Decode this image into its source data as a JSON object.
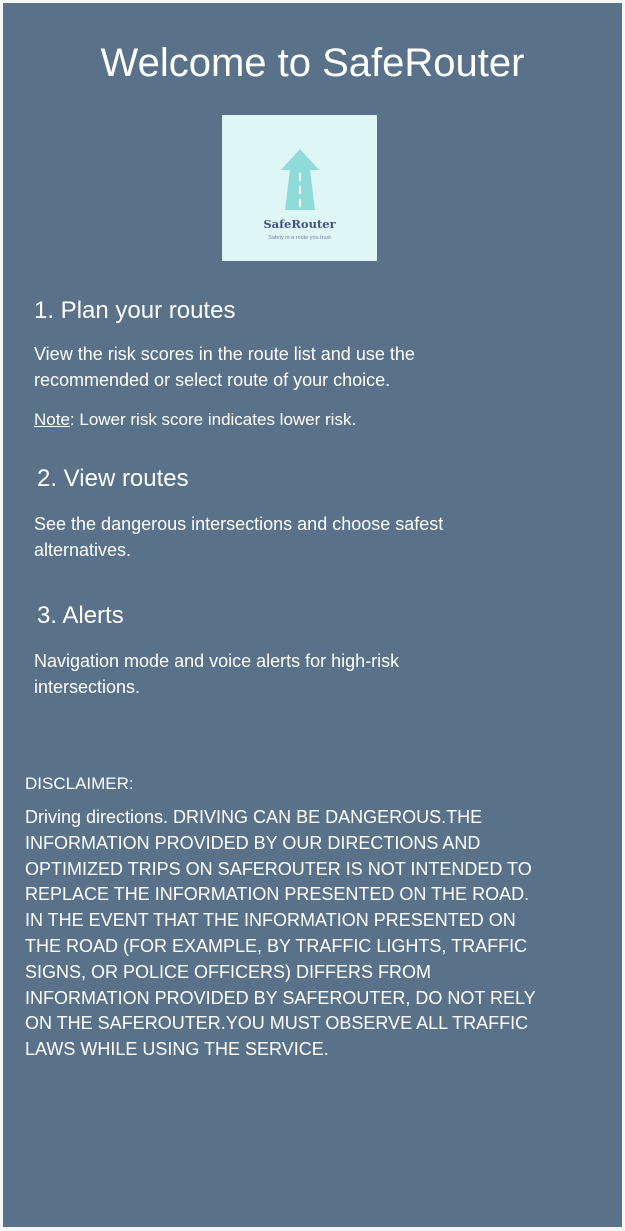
{
  "app": {
    "title": "Welcome to SafeRouter"
  },
  "logo": {
    "name": "SafeRouter",
    "tagline": "Safety in a route you trust",
    "icon": "road-arrow-icon",
    "colors": {
      "background": "#dff6f6",
      "arrow": "#8fdbd9",
      "text": "#3e5488"
    }
  },
  "sections": [
    {
      "heading": "1. Plan your routes",
      "body": "View the risk scores in the route list and use the recommended or select route of your choice.",
      "note_label": "Note",
      "note_text": ": Lower risk score indicates lower risk."
    },
    {
      "heading": "2. View routes",
      "body": "See the dangerous intersections and choose safest alternatives."
    },
    {
      "heading": "3. Alerts",
      "body": "Navigation mode and voice alerts for high-risk intersections."
    }
  ],
  "disclaimer": {
    "title": "DISCLAIMER:",
    "text": "Driving directions. DRIVING CAN BE DANGEROUS.THE\nINFORMATION PROVIDED BY OUR DIRECTIONS AND\nOPTIMIZED TRIPS ON SAFEROUTER IS NOT INTENDED TO\nREPLACE THE INFORMATION PRESENTED ON THE ROAD.\nIN THE EVENT THAT THE INFORMATION PRESENTED ON\nTHE ROAD (FOR EXAMPLE, BY TRAFFIC LIGHTS, TRAFFIC\nSIGNS, OR POLICE OFFICERS) DIFFERS FROM\nINFORMATION PROVIDED BY SAFEROUTER, DO NOT RELY\nON THE SAFEROUTER.YOU MUST OBSERVE ALL TRAFFIC\nLAWS WHILE USING THE SERVICE."
  },
  "theme": {
    "background": "#5a7289",
    "text": "#ffffff"
  }
}
